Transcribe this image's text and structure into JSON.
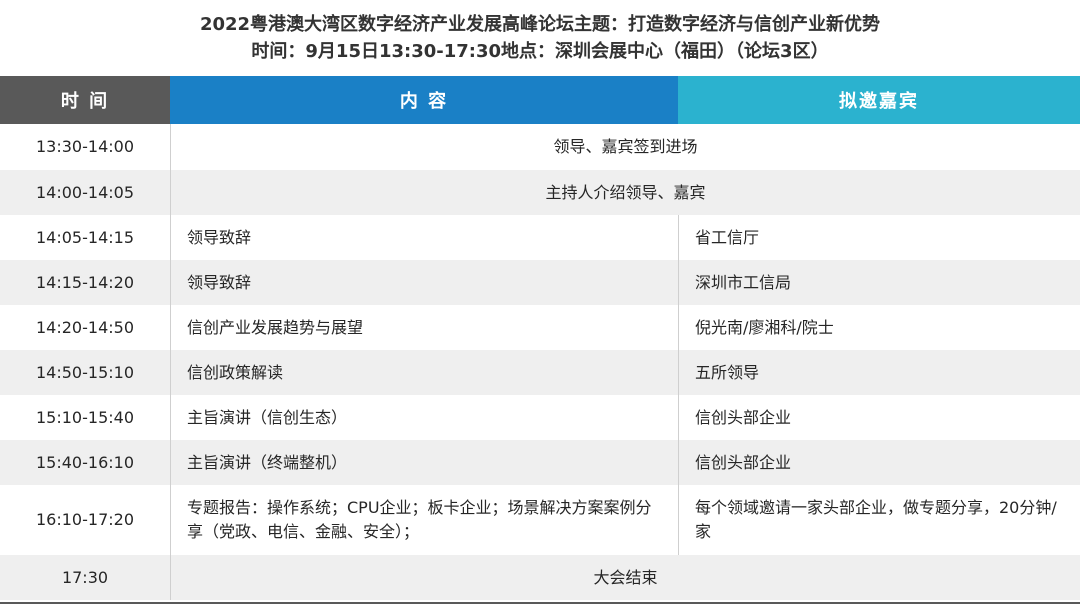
{
  "title": {
    "line1": "2022粤港澳大湾区数字经济产业发展高峰论坛主题：打造数字经济与信创产业新优势",
    "line2": "时间：9月15日13:30-17:30地点：深圳会展中心（福田）（论坛3区）"
  },
  "header": {
    "time": "时 间",
    "content": "内 容",
    "guest": "拟邀嘉宾"
  },
  "rows": [
    {
      "time": "13:30-14:00",
      "merged": "领导、嘉宾签到进场"
    },
    {
      "time": "14:00-14:05",
      "merged": "主持人介绍领导、嘉宾"
    },
    {
      "time": "14:05-14:15",
      "content": "领导致辞",
      "guest": "省工信厅"
    },
    {
      "time": "14:15-14:20",
      "content": "领导致辞",
      "guest": "深圳市工信局"
    },
    {
      "time": "14:20-14:50",
      "content": "信创产业发展趋势与展望",
      "guest": "倪光南/廖湘科/院士"
    },
    {
      "time": "14:50-15:10",
      "content": "信创政策解读",
      "guest": "五所领导"
    },
    {
      "time": "15:10-15:40",
      "content": "主旨演讲（信创生态）",
      "guest": "信创头部企业"
    },
    {
      "time": "15:40-16:10",
      "content": "主旨演讲（终端整机）",
      "guest": "信创头部企业"
    },
    {
      "time": "16:10-17:20",
      "content": "专题报告：操作系统；CPU企业；板卡企业；场景解决方案案例分享（党政、电信、金融、安全）；",
      "guest": "每个领域邀请一家头部企业，做专题分享，20分钟/家"
    },
    {
      "time": "17:30",
      "merged": "大会结束"
    }
  ]
}
